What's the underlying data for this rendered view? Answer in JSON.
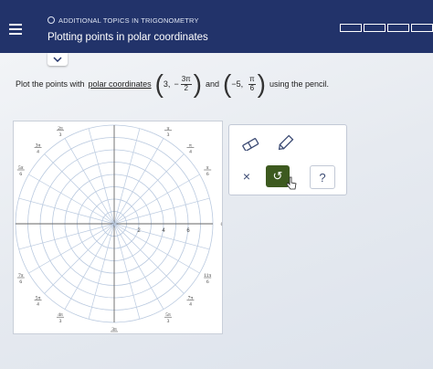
{
  "header": {
    "topic": "ADDITIONAL TOPICS IN TRIGONOMETRY",
    "title": "Plotting points in polar coordinates",
    "progress_segments": 4
  },
  "prompt": {
    "lead": "Plot the points with",
    "link": "polar coordinates",
    "point1": {
      "r": "3,",
      "sign": "−",
      "num": "3π",
      "den": "2"
    },
    "and": "and",
    "point2": {
      "r": "−5,",
      "num": "π",
      "den": "6"
    },
    "tail": "using the pencil."
  },
  "polar_grid": {
    "radial_labels": [
      "2",
      "4",
      "6"
    ],
    "angle_labels": {
      "a0": "0",
      "a30": {
        "n": "π",
        "d": "6"
      },
      "a45": {
        "n": "π",
        "d": "4"
      },
      "a60": {
        "n": "π",
        "d": "3"
      },
      "a90": {
        "n": "π",
        "d": "2"
      },
      "a120": {
        "n": "2π",
        "d": "3"
      },
      "a135": {
        "n": "3π",
        "d": "4"
      },
      "a150": {
        "n": "5π",
        "d": "6"
      },
      "a180": "π",
      "a210": {
        "n": "7π",
        "d": "6"
      },
      "a225": {
        "n": "5π",
        "d": "4"
      },
      "a240": {
        "n": "4π",
        "d": "3"
      },
      "a270": {
        "n": "3π",
        "d": "2"
      },
      "a300": {
        "n": "5π",
        "d": "3"
      },
      "a315": {
        "n": "7π",
        "d": "4"
      },
      "a330": {
        "n": "11π",
        "d": "6"
      }
    }
  },
  "tools": {
    "eraser": "eraser-icon",
    "pencil": "pencil-icon",
    "clear": "×",
    "undo": "↺",
    "help": "?",
    "undo_color": "#3d5a1f"
  }
}
